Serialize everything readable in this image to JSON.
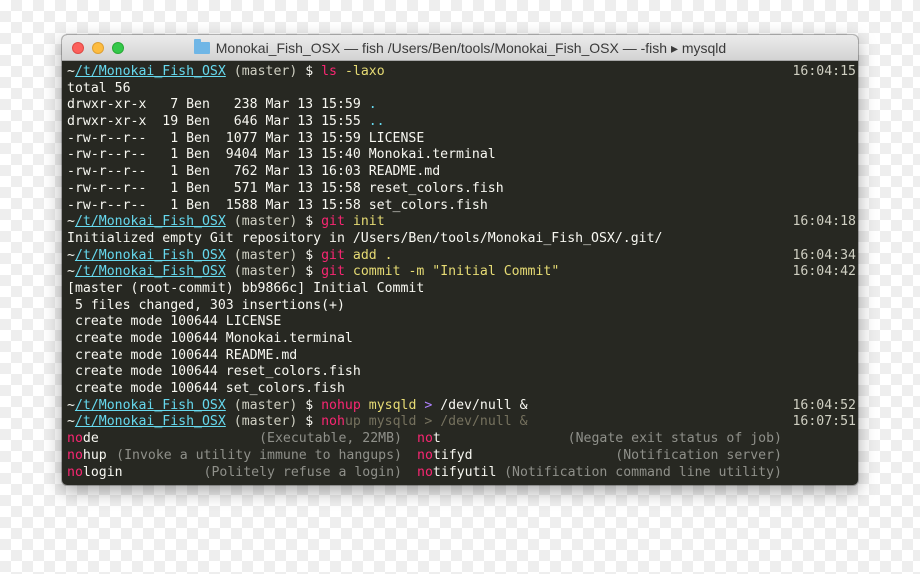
{
  "window": {
    "title": "Monokai_Fish_OSX — fish  /Users/Ben/tools/Monokai_Fish_OSX — -fish ▸ mysqld"
  },
  "prompt": {
    "open": "~",
    "cwd": "/t/Monokai_Fish_OSX",
    "branch": " (master)",
    "symbol": " $ "
  },
  "session": {
    "cmd1": {
      "name": "ls",
      "args": " -laxo",
      "time": "16:04:15"
    },
    "ls_output": {
      "total": "total 56",
      "rows": [
        {
          "meta": "drwxr-xr-x   7 Ben   238 Mar 13 15:59 ",
          "name": "."
        },
        {
          "meta": "drwxr-xr-x  19 Ben   646 Mar 13 15:55 ",
          "name": ".."
        },
        {
          "meta": "-rw-r--r--   1 Ben  1077 Mar 13 15:59 ",
          "name": "LICENSE"
        },
        {
          "meta": "-rw-r--r--   1 Ben  9404 Mar 13 15:40 ",
          "name": "Monokai.terminal"
        },
        {
          "meta": "-rw-r--r--   1 Ben   762 Mar 13 16:03 ",
          "name": "README.md"
        },
        {
          "meta": "-rw-r--r--   1 Ben   571 Mar 13 15:58 ",
          "name": "reset_colors.fish"
        },
        {
          "meta": "-rw-r--r--   1 Ben  1588 Mar 13 15:58 ",
          "name": "set_colors.fish"
        }
      ]
    },
    "cmd2": {
      "name": "git",
      "args": " init",
      "time": "16:04:18"
    },
    "init_output": "Initialized empty Git repository in /Users/Ben/tools/Monokai_Fish_OSX/.git/",
    "cmd3": {
      "name": "git",
      "args": " add .",
      "time": "16:04:34"
    },
    "cmd4": {
      "name": "git",
      "args": " commit -m ",
      "quoted": "\"Initial Commit\"",
      "time": "16:04:42"
    },
    "commit_output": [
      "[master (root-commit) bb9866c] Initial Commit",
      " 5 files changed, 303 insertions(+)",
      " create mode 100644 LICENSE",
      " create mode 100644 Monokai.terminal",
      " create mode 100644 README.md",
      " create mode 100644 reset_colors.fish",
      " create mode 100644 set_colors.fish"
    ],
    "cmd5": {
      "name": "nohup",
      "arg": " mysqld ",
      "redirect": ">",
      "rest": " /dev/null &",
      "time": "16:04:52"
    },
    "current": {
      "typed": "no",
      "autosuggest_cursor": "h",
      "autosuggest_rest": "up mysqld > /dev/null &",
      "time": "16:07:51"
    },
    "completions": [
      {
        "match": "no",
        "rest": "de",
        "desc": "(Executable, 22MB)"
      },
      {
        "match": "no",
        "rest": "t",
        "desc": "(Negate exit status of job)"
      },
      {
        "match": "no",
        "rest": "hup",
        "desc": "(Invoke a utility immune to hangups)"
      },
      {
        "match": "no",
        "rest": "tifyd",
        "desc": "(Notification server)"
      },
      {
        "match": "no",
        "rest": "login",
        "desc": "(Politely refuse a login)"
      },
      {
        "match": "no",
        "rest": "tifyutil",
        "desc": "(Notification command line utility)"
      }
    ]
  },
  "colors": {
    "background": "#272822",
    "foreground": "#f8f8f2",
    "pink": "#f92672",
    "yellow": "#e6db74",
    "cyan": "#66d9ef",
    "purple": "#ae81ff",
    "comment": "#75715e"
  },
  "icons": {
    "title_icon": "folder-icon",
    "traffic_lights": [
      "close-button",
      "minimize-button",
      "zoom-button"
    ]
  }
}
